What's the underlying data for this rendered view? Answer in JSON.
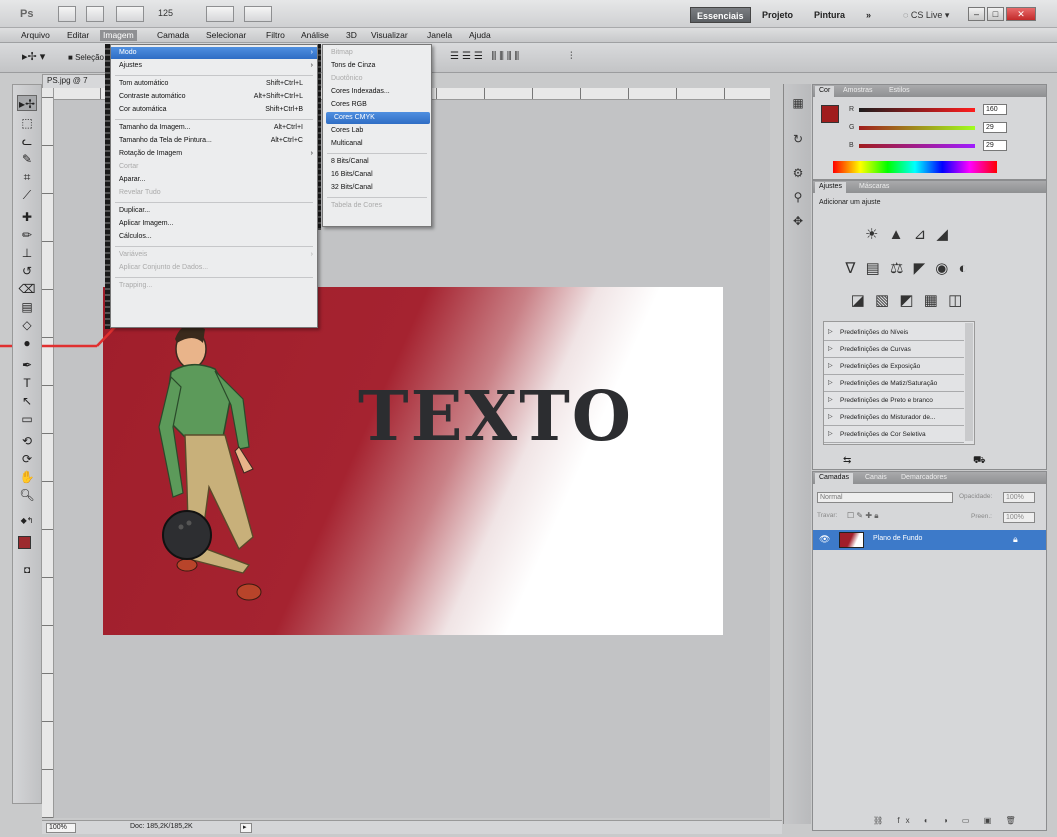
{
  "appbar": {
    "logo": "Ps",
    "zoom": "125",
    "workspaces": [
      "Essenciais",
      "Projeto",
      "Pintura"
    ],
    "more": "»",
    "cslive": "CS Live"
  },
  "menubar": [
    "Arquivo",
    "Editar",
    "Imagem",
    "Camada",
    "Selecionar",
    "Filtro",
    "Análise",
    "3D",
    "Visualizar",
    "Janela",
    "Ajuda"
  ],
  "optbar": {
    "tool_label": "Seleção"
  },
  "document": {
    "tab": "PS.jpg @ 7",
    "artwork_text": "TEXTO"
  },
  "status": {
    "zoom": "100%",
    "doc": "Doc: 185,2K/185,2K"
  },
  "image_menu": {
    "items": [
      {
        "label": "Modo",
        "arrow": "›",
        "state": "hl"
      },
      {
        "label": "Ajustes",
        "arrow": "›"
      },
      {
        "sep": true
      },
      {
        "label": "Tom automático",
        "sc": "Shift+Ctrl+L"
      },
      {
        "label": "Contraste automático",
        "sc": "Alt+Shift+Ctrl+L"
      },
      {
        "label": "Cor automática",
        "sc": "Shift+Ctrl+B"
      },
      {
        "sep": true
      },
      {
        "label": "Tamanho da Imagem...",
        "sc": "Alt+Ctrl+I"
      },
      {
        "label": "Tamanho da Tela de Pintura...",
        "sc": "Alt+Ctrl+C"
      },
      {
        "label": "Rotação de Imagem",
        "arrow": "›"
      },
      {
        "label": "Cortar",
        "state": "disabled"
      },
      {
        "label": "Aparar..."
      },
      {
        "label": "Revelar Tudo",
        "state": "disabled"
      },
      {
        "sep": true
      },
      {
        "label": "Duplicar..."
      },
      {
        "label": "Aplicar Imagem..."
      },
      {
        "label": "Cálculos..."
      },
      {
        "sep": true
      },
      {
        "label": "Variáveis",
        "arrow": "›",
        "state": "disabled"
      },
      {
        "label": "Aplicar Conjunto de Dados...",
        "state": "disabled"
      },
      {
        "sep": true
      },
      {
        "label": "Trapping...",
        "state": "disabled"
      }
    ]
  },
  "mode_menu": {
    "items": [
      {
        "label": "Bitmap",
        "state": "disabled"
      },
      {
        "label": "Tons de Cinza"
      },
      {
        "label": "Duotônico",
        "state": "disabled"
      },
      {
        "label": "Cores Indexadas..."
      },
      {
        "label": "Cores RGB"
      },
      {
        "label": "Cores CMYK",
        "state": "hl"
      },
      {
        "label": "Cores Lab"
      },
      {
        "label": "Multicanal"
      },
      {
        "sep": true
      },
      {
        "label": "8 Bits/Canal"
      },
      {
        "label": "16 Bits/Canal"
      },
      {
        "label": "32 Bits/Canal"
      },
      {
        "sep": true
      },
      {
        "label": "Tabela de Cores",
        "state": "disabled"
      }
    ]
  },
  "color_panel": {
    "tabs": [
      "Cor",
      "Amostras",
      "Estilos"
    ],
    "channels": [
      {
        "name": "R",
        "value": "160"
      },
      {
        "name": "G",
        "value": "29"
      },
      {
        "name": "B",
        "value": "29"
      }
    ],
    "fg_color": "#a01d1d"
  },
  "adjust_panel": {
    "tabs": [
      "Ajustes",
      "Máscaras"
    ],
    "heading": "Adicionar um ajuste",
    "rows": [
      "☀ ▲ ⊿ ◢",
      "∇ ▤ ⚖ ◤ ◉ ◐",
      "◪ ▧ ◩ ▦ ◫"
    ],
    "presets": [
      "Predefinições do Níveis",
      "Predefinições de Curvas",
      "Predefinições de Exposição",
      "Predefinições de Matiz/Saturação",
      "Predefinições de Preto e branco",
      "Predefinições do Misturador de...",
      "Predefinições de Cor Seletiva"
    ]
  },
  "layers_panel": {
    "tabs": [
      "Camadas",
      "Canais",
      "Demarcadores"
    ],
    "blend_mode": "Normal",
    "opacity_label": "Opacidade:",
    "opacity": "100%",
    "lock_label": "Travar:",
    "fill_label": "Preen.:",
    "fill": "100%",
    "layer_name": "Plano de Fundo"
  },
  "colors": {
    "accent": "#3d7ac9",
    "red_swatch": "#9c2a2e",
    "artwork_red": "#a01e2b",
    "callout": "#e03030"
  }
}
